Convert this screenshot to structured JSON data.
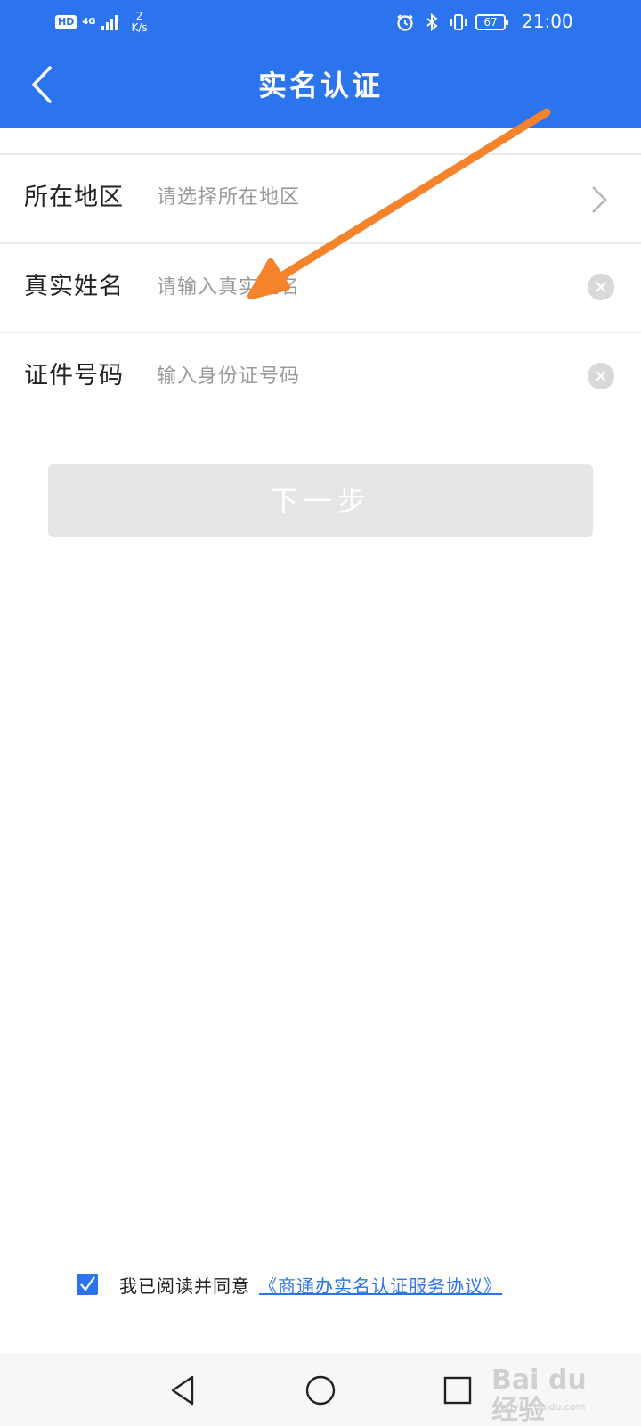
{
  "status_bar": {
    "hd": "HD",
    "network": "4G",
    "speed_value": "2",
    "speed_unit": "K/s",
    "battery": "67",
    "time": "21:00",
    "icons": [
      "alarm-icon",
      "bluetooth-icon",
      "vibrate-icon",
      "battery-icon"
    ]
  },
  "header": {
    "title": "实名认证",
    "back_icon": "chevron-left-icon"
  },
  "form": {
    "region": {
      "label": "所在地区",
      "placeholder": "请选择所在地区"
    },
    "name": {
      "label": "真实姓名",
      "placeholder": "请输入真实姓名"
    },
    "id_number": {
      "label": "证件号码",
      "placeholder": "输入身份证号码"
    }
  },
  "next_button": {
    "label": "下一步"
  },
  "agreement": {
    "checked": true,
    "text": "我已阅读并同意",
    "link": "《商通办实名认证服务协议》"
  },
  "nav_bar": {
    "icons": [
      "back-triangle-icon",
      "home-circle-icon",
      "recent-square-icon"
    ]
  },
  "watermark": {
    "text": "Bai du 经验",
    "sub": "jingyan.baidu.com"
  },
  "colors": {
    "primary": "#2b74ee",
    "annotation_arrow": "#f4832c",
    "disabled_button": "#e6e6e6"
  }
}
